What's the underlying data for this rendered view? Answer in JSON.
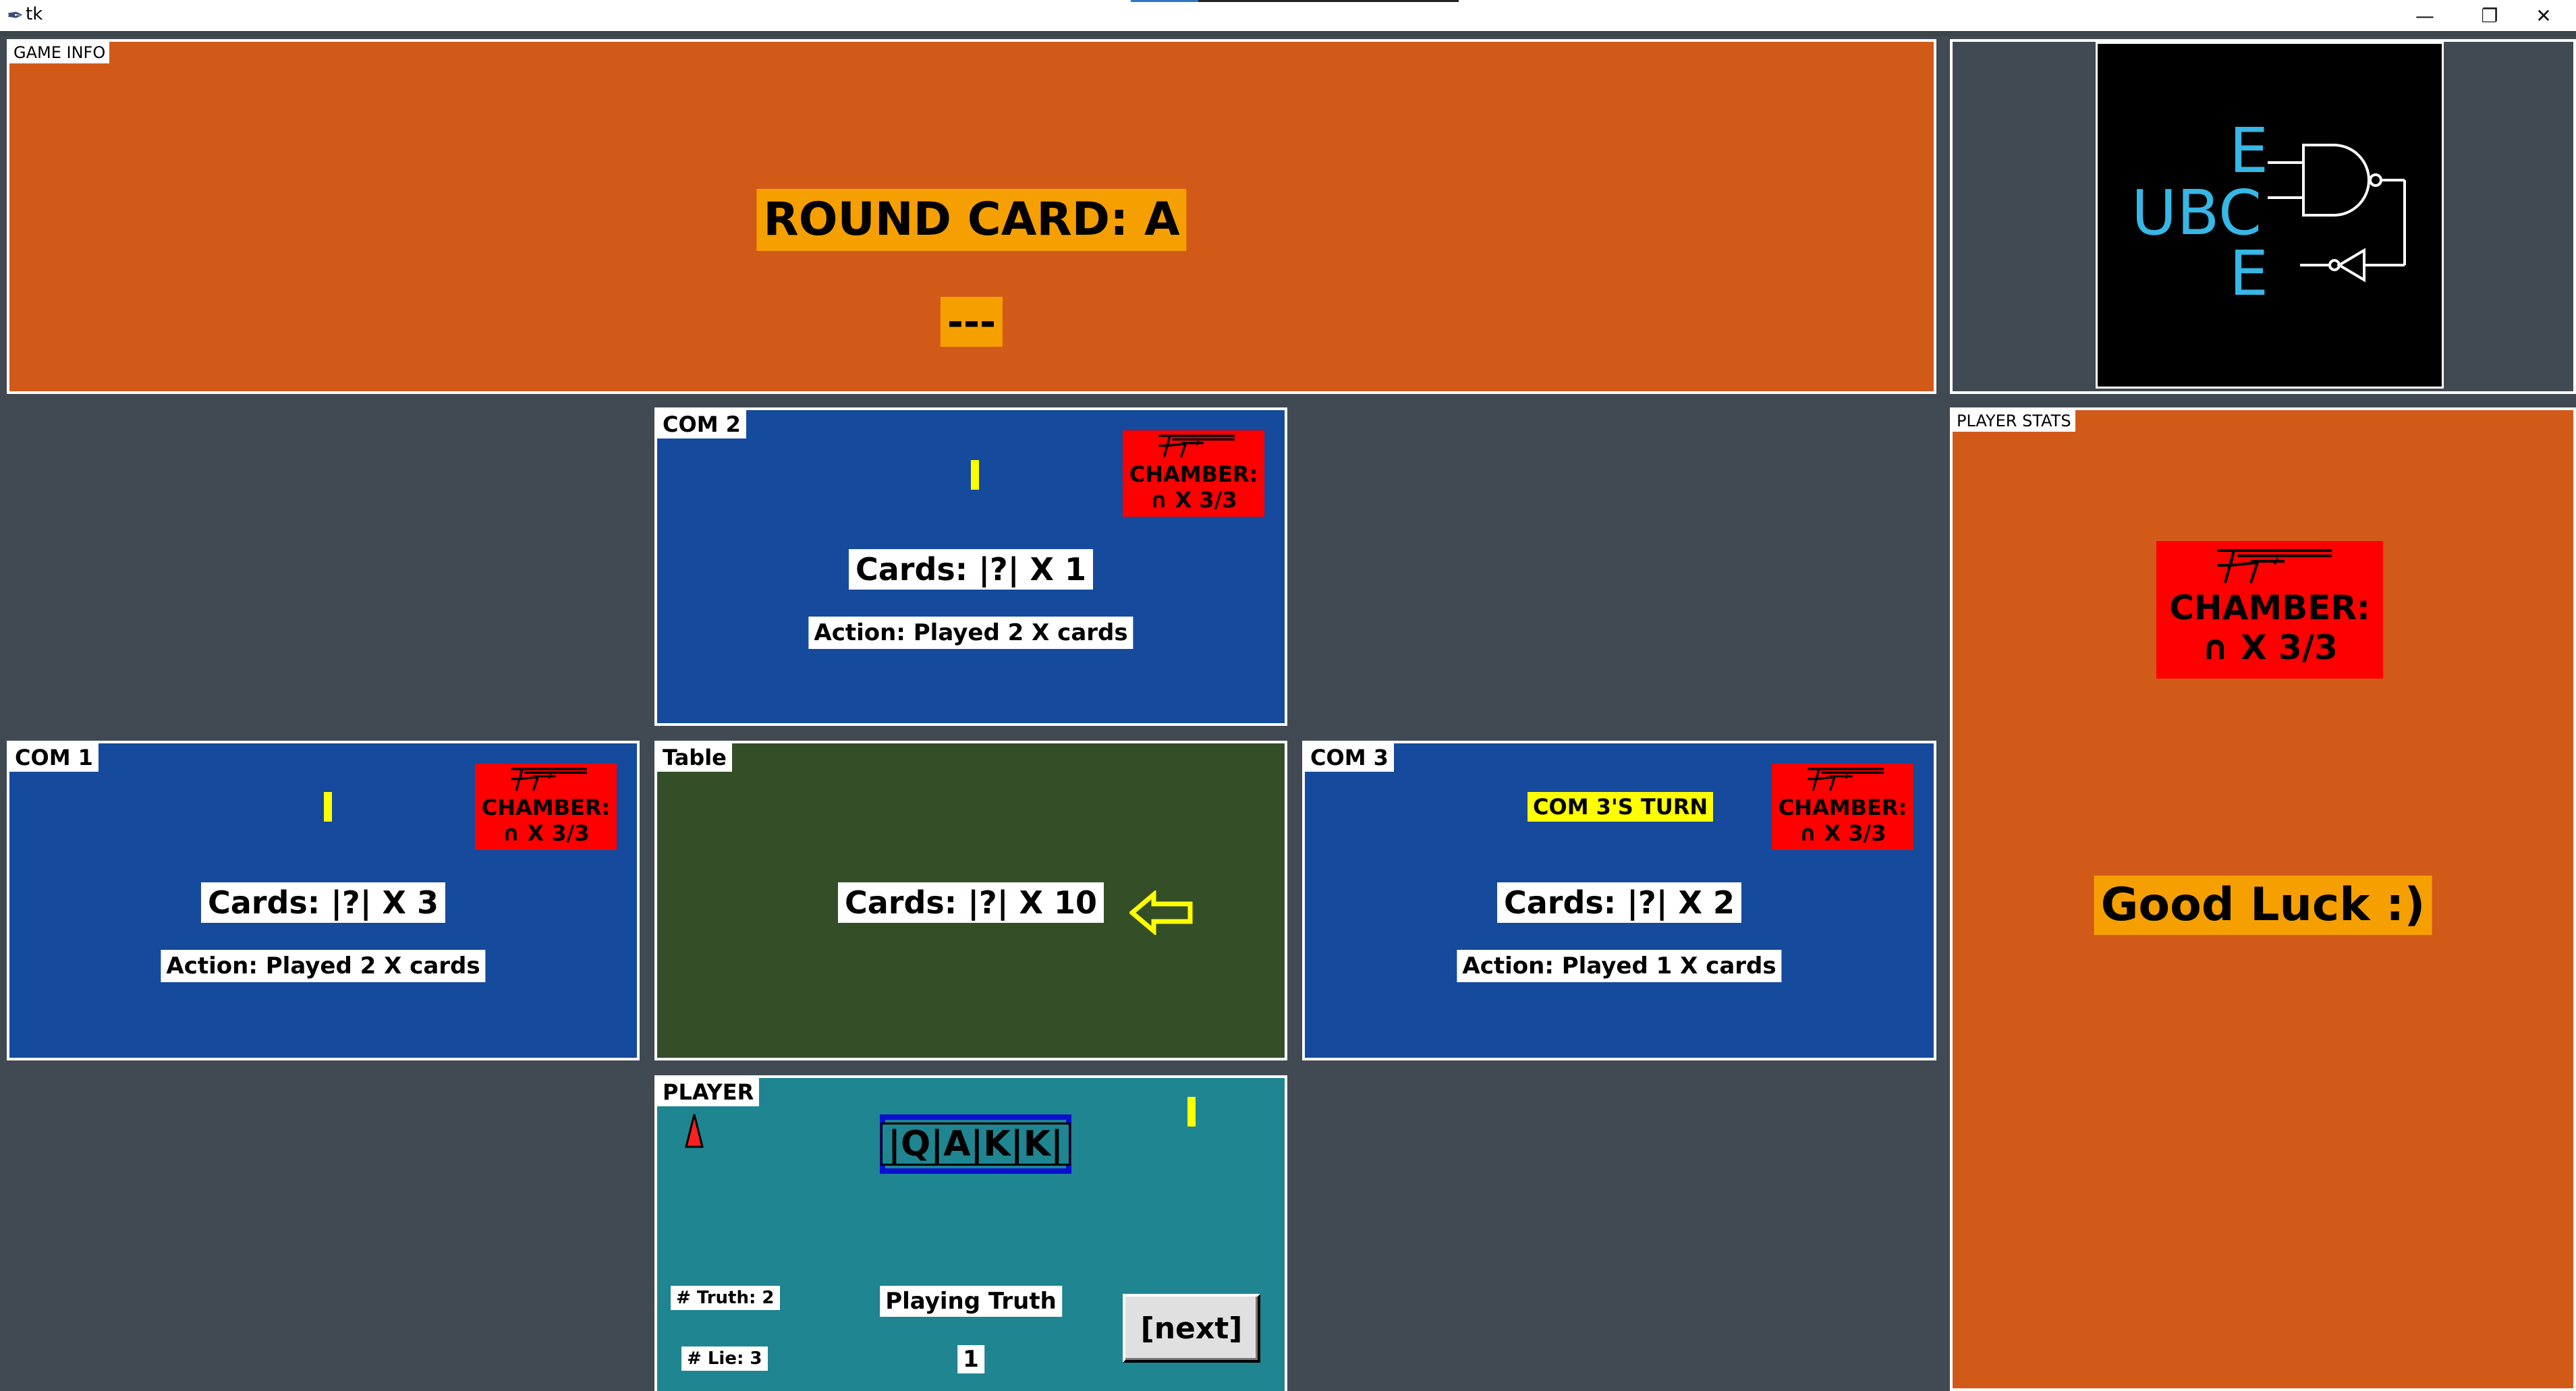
{
  "window": {
    "title": "tk",
    "minimize_glyph": "—",
    "restore_glyph": "❐",
    "close_glyph": "✕"
  },
  "game_info": {
    "label": "GAME INFO",
    "round_card": "ROUND CARD: A",
    "status": "---"
  },
  "logo": {
    "text_ubc": "UBC",
    "text_e": "E",
    "text_e2": "E"
  },
  "player_stats": {
    "label": "PLAYER STATS",
    "chamber_line1": "CHAMBER:",
    "chamber_line2": "∩ X 3/3",
    "message": "Good Luck :)"
  },
  "com2": {
    "label": "COM 2",
    "chamber_line1": "CHAMBER:",
    "chamber_line2": "∩ X 3/3",
    "cards": "Cards: |?| X 1",
    "action": "Action: Played 2 X cards"
  },
  "com1": {
    "label": "COM 1",
    "chamber_line1": "CHAMBER:",
    "chamber_line2": "∩ X 3/3",
    "cards": "Cards: |?| X 3",
    "action": "Action: Played 2 X cards"
  },
  "table": {
    "label": "Table",
    "cards": "Cards: |?| X 10",
    "arrow_icon": "arrow-left-icon"
  },
  "com3": {
    "label": "COM 3",
    "turn": "COM 3'S TURN",
    "chamber_line1": "CHAMBER:",
    "chamber_line2": "∩ X 3/3",
    "cards": "Cards: |?| X 2",
    "action": "Action: Played 1 X cards"
  },
  "player": {
    "label": "PLAYER",
    "hand": "|Q|A|K|K|",
    "truth_count": "# Truth: 2",
    "lie_count": "# Lie: 3",
    "mode": "Playing Truth",
    "counter": "1",
    "next_button": "[next]"
  },
  "colors": {
    "background": "#414a52",
    "orange_panel": "#d15a18",
    "blue_panel": "#154a9c",
    "table_green": "#344f27",
    "player_teal": "#1e8591",
    "highlight_orange": "#f5a000",
    "chamber_red": "#ff0000",
    "turn_yellow": "#ffff00"
  }
}
